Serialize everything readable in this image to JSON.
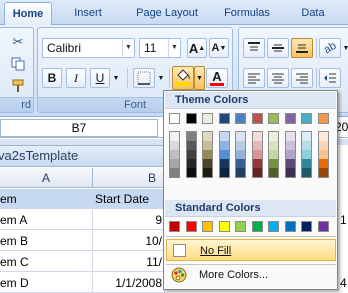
{
  "ribbon": {
    "tabs": [
      "Home",
      "Insert",
      "Page Layout",
      "Formulas",
      "Data"
    ],
    "active_tab": "Home",
    "clipboard": {
      "label_partial": "rd"
    },
    "font": {
      "family": "Calibri",
      "size": "11",
      "bold": "B",
      "italic": "I",
      "underline": "U",
      "grow": "A",
      "shrink": "A",
      "color_button": "A",
      "group_label": "Font"
    }
  },
  "formula_bar": {
    "name_box": "B7",
    "cut_off_value": "20"
  },
  "workbook": {
    "title": "va2sTemplate",
    "columns": [
      "A",
      "B"
    ],
    "rows": [
      {
        "a": "em",
        "b": "Start Date"
      },
      {
        "a": "em A",
        "b": "9"
      },
      {
        "a": "em B",
        "b": "10/"
      },
      {
        "a": "em C",
        "b": "11/"
      },
      {
        "a": "em D",
        "b": "1/1/2008"
      }
    ],
    "side_digits": [
      "1",
      "4"
    ]
  },
  "color_menu": {
    "theme_title": "Theme Colors",
    "standard_title": "Standard Colors",
    "no_fill": "No Fill",
    "more_colors": "More Colors...",
    "theme_top": [
      "#ffffff",
      "#000000",
      "#eeece1",
      "#1f497d",
      "#4f81bd",
      "#c0504d",
      "#9bbb59",
      "#8064a2",
      "#4bacc6",
      "#f79646"
    ],
    "theme_shades": [
      [
        "#f2f2f2",
        "#d9d9d9",
        "#bfbfbf",
        "#a6a6a6",
        "#808080"
      ],
      [
        "#7f7f7f",
        "#595959",
        "#404040",
        "#262626",
        "#0d0d0d"
      ],
      [
        "#ddd9c3",
        "#c4bd97",
        "#948a54",
        "#4a452a",
        "#1e1c11"
      ],
      [
        "#c6d9f0",
        "#8db3e2",
        "#548dd4",
        "#17365d",
        "#0f243e"
      ],
      [
        "#dbe5f1",
        "#b8cce4",
        "#95b3d7",
        "#366092",
        "#244061"
      ],
      [
        "#f2dcdb",
        "#e5b9b7",
        "#d99694",
        "#953734",
        "#632423"
      ],
      [
        "#ebf1dd",
        "#d7e3bc",
        "#c3d69b",
        "#76923c",
        "#4f6128"
      ],
      [
        "#e5e0ec",
        "#ccc1d9",
        "#b2a2c7",
        "#5f497a",
        "#3f3151"
      ],
      [
        "#dbeef3",
        "#b7dde8",
        "#92cddc",
        "#31859b",
        "#205867"
      ],
      [
        "#fdeada",
        "#fbd5b5",
        "#fac08f",
        "#e36c09",
        "#974806"
      ]
    ],
    "standard": [
      "#c00000",
      "#ff0000",
      "#ffc000",
      "#ffff00",
      "#92d050",
      "#00b050",
      "#00b0f0",
      "#0070c0",
      "#002060",
      "#7030a0"
    ]
  }
}
